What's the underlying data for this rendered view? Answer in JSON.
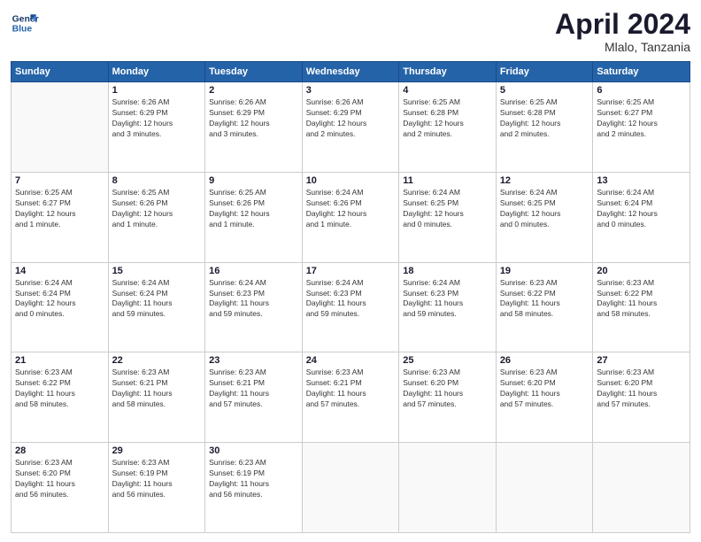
{
  "logo": {
    "line1": "General",
    "line2": "Blue"
  },
  "title": "April 2024",
  "location": "Mlalo, Tanzania",
  "days_of_week": [
    "Sunday",
    "Monday",
    "Tuesday",
    "Wednesday",
    "Thursday",
    "Friday",
    "Saturday"
  ],
  "weeks": [
    [
      {
        "day": "",
        "info": ""
      },
      {
        "day": "1",
        "info": "Sunrise: 6:26 AM\nSunset: 6:29 PM\nDaylight: 12 hours\nand 3 minutes."
      },
      {
        "day": "2",
        "info": "Sunrise: 6:26 AM\nSunset: 6:29 PM\nDaylight: 12 hours\nand 3 minutes."
      },
      {
        "day": "3",
        "info": "Sunrise: 6:26 AM\nSunset: 6:29 PM\nDaylight: 12 hours\nand 2 minutes."
      },
      {
        "day": "4",
        "info": "Sunrise: 6:25 AM\nSunset: 6:28 PM\nDaylight: 12 hours\nand 2 minutes."
      },
      {
        "day": "5",
        "info": "Sunrise: 6:25 AM\nSunset: 6:28 PM\nDaylight: 12 hours\nand 2 minutes."
      },
      {
        "day": "6",
        "info": "Sunrise: 6:25 AM\nSunset: 6:27 PM\nDaylight: 12 hours\nand 2 minutes."
      }
    ],
    [
      {
        "day": "7",
        "info": "Sunrise: 6:25 AM\nSunset: 6:27 PM\nDaylight: 12 hours\nand 1 minute."
      },
      {
        "day": "8",
        "info": "Sunrise: 6:25 AM\nSunset: 6:26 PM\nDaylight: 12 hours\nand 1 minute."
      },
      {
        "day": "9",
        "info": "Sunrise: 6:25 AM\nSunset: 6:26 PM\nDaylight: 12 hours\nand 1 minute."
      },
      {
        "day": "10",
        "info": "Sunrise: 6:24 AM\nSunset: 6:26 PM\nDaylight: 12 hours\nand 1 minute."
      },
      {
        "day": "11",
        "info": "Sunrise: 6:24 AM\nSunset: 6:25 PM\nDaylight: 12 hours\nand 0 minutes."
      },
      {
        "day": "12",
        "info": "Sunrise: 6:24 AM\nSunset: 6:25 PM\nDaylight: 12 hours\nand 0 minutes."
      },
      {
        "day": "13",
        "info": "Sunrise: 6:24 AM\nSunset: 6:24 PM\nDaylight: 12 hours\nand 0 minutes."
      }
    ],
    [
      {
        "day": "14",
        "info": "Sunrise: 6:24 AM\nSunset: 6:24 PM\nDaylight: 12 hours\nand 0 minutes."
      },
      {
        "day": "15",
        "info": "Sunrise: 6:24 AM\nSunset: 6:24 PM\nDaylight: 11 hours\nand 59 minutes."
      },
      {
        "day": "16",
        "info": "Sunrise: 6:24 AM\nSunset: 6:23 PM\nDaylight: 11 hours\nand 59 minutes."
      },
      {
        "day": "17",
        "info": "Sunrise: 6:24 AM\nSunset: 6:23 PM\nDaylight: 11 hours\nand 59 minutes."
      },
      {
        "day": "18",
        "info": "Sunrise: 6:24 AM\nSunset: 6:23 PM\nDaylight: 11 hours\nand 59 minutes."
      },
      {
        "day": "19",
        "info": "Sunrise: 6:23 AM\nSunset: 6:22 PM\nDaylight: 11 hours\nand 58 minutes."
      },
      {
        "day": "20",
        "info": "Sunrise: 6:23 AM\nSunset: 6:22 PM\nDaylight: 11 hours\nand 58 minutes."
      }
    ],
    [
      {
        "day": "21",
        "info": "Sunrise: 6:23 AM\nSunset: 6:22 PM\nDaylight: 11 hours\nand 58 minutes."
      },
      {
        "day": "22",
        "info": "Sunrise: 6:23 AM\nSunset: 6:21 PM\nDaylight: 11 hours\nand 58 minutes."
      },
      {
        "day": "23",
        "info": "Sunrise: 6:23 AM\nSunset: 6:21 PM\nDaylight: 11 hours\nand 57 minutes."
      },
      {
        "day": "24",
        "info": "Sunrise: 6:23 AM\nSunset: 6:21 PM\nDaylight: 11 hours\nand 57 minutes."
      },
      {
        "day": "25",
        "info": "Sunrise: 6:23 AM\nSunset: 6:20 PM\nDaylight: 11 hours\nand 57 minutes."
      },
      {
        "day": "26",
        "info": "Sunrise: 6:23 AM\nSunset: 6:20 PM\nDaylight: 11 hours\nand 57 minutes."
      },
      {
        "day": "27",
        "info": "Sunrise: 6:23 AM\nSunset: 6:20 PM\nDaylight: 11 hours\nand 57 minutes."
      }
    ],
    [
      {
        "day": "28",
        "info": "Sunrise: 6:23 AM\nSunset: 6:20 PM\nDaylight: 11 hours\nand 56 minutes."
      },
      {
        "day": "29",
        "info": "Sunrise: 6:23 AM\nSunset: 6:19 PM\nDaylight: 11 hours\nand 56 minutes."
      },
      {
        "day": "30",
        "info": "Sunrise: 6:23 AM\nSunset: 6:19 PM\nDaylight: 11 hours\nand 56 minutes."
      },
      {
        "day": "",
        "info": ""
      },
      {
        "day": "",
        "info": ""
      },
      {
        "day": "",
        "info": ""
      },
      {
        "day": "",
        "info": ""
      }
    ]
  ]
}
